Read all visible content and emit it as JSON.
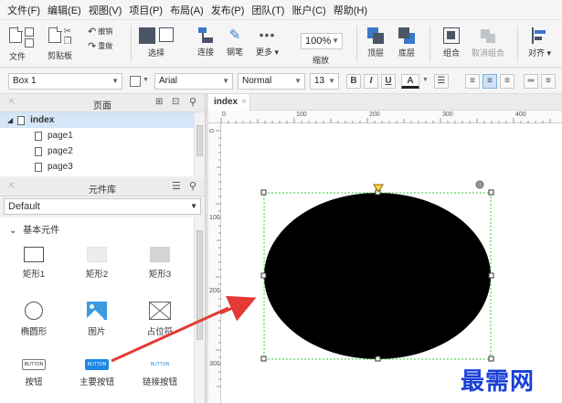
{
  "menu": [
    "文件(F)",
    "编辑(E)",
    "视图(V)",
    "项目(P)",
    "布局(A)",
    "发布(P)",
    "团队(T)",
    "账户(C)",
    "帮助(H)"
  ],
  "toolbar": {
    "file": "文件",
    "clipboard": "剪贴板",
    "undo": "撤销",
    "redo": "重做",
    "select": "选择",
    "connect": "连接",
    "pen": "钢笔",
    "more": "更多",
    "zoom_value": "100%",
    "zoom": "缩放",
    "top": "顶层",
    "bottom": "底层",
    "group": "组合",
    "ungroup": "取消组合",
    "align": "对齐"
  },
  "format": {
    "widget_name": "Box 1",
    "font": "Arial",
    "style": "Normal",
    "size": "13",
    "bold": "B",
    "italic": "I",
    "underline": "U",
    "font_color": "A"
  },
  "pages_panel": {
    "title": "页面",
    "root": "index",
    "pages": [
      "page1",
      "page2",
      "page3"
    ]
  },
  "library_panel": {
    "title": "元件库",
    "library": "Default",
    "section": "基本元件",
    "widgets": [
      "矩形1",
      "矩形2",
      "矩形3",
      "椭圆形",
      "图片",
      "占位符",
      "按钮",
      "主要按钮",
      "链接按钮"
    ],
    "button_text": "BUTTON"
  },
  "canvas": {
    "tab": "index",
    "tab_close": "×",
    "ruler_h": [
      "0",
      "100",
      "200",
      "300",
      "400"
    ],
    "ruler_v": [
      "0",
      "100",
      "200",
      "300"
    ]
  },
  "watermark": "最需网",
  "colors": {
    "accent": "#3c78c8",
    "shape_fill": "#000000",
    "selection": "#33cc33",
    "annotation_arrow": "#e53935",
    "watermark": "#1a3fd6"
  }
}
